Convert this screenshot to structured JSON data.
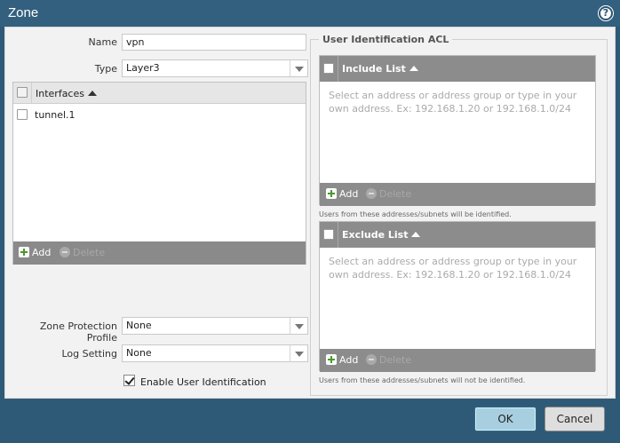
{
  "window": {
    "title": "Zone"
  },
  "form": {
    "name_label": "Name",
    "name_value": "vpn",
    "type_label": "Type",
    "type_value": "Layer3",
    "zpp_label": "Zone Protection Profile",
    "zpp_value": "None",
    "log_label": "Log Setting",
    "log_value": "None",
    "enable_uid_label": "Enable User Identification",
    "enable_uid_checked": true
  },
  "interfaces": {
    "header": "Interfaces",
    "rows": [
      "tunnel.1"
    ],
    "add_label": "Add",
    "delete_label": "Delete"
  },
  "acl": {
    "legend": "User Identification ACL",
    "include": {
      "header": "Include List",
      "placeholder": "Select an address or address group or type in your own address. Ex: 192.168.1.20 or 192.168.1.0/24",
      "add_label": "Add",
      "delete_label": "Delete",
      "hint": "Users from these addresses/subnets will be identified."
    },
    "exclude": {
      "header": "Exclude List",
      "placeholder": "Select an address or address group or type in your own address. Ex: 192.168.1.20 or 192.168.1.0/24",
      "add_label": "Add",
      "delete_label": "Delete",
      "hint": "Users from these addresses/subnets will not be identified."
    }
  },
  "footer": {
    "ok_label": "OK",
    "cancel_label": "Cancel"
  },
  "icons": {
    "help": "help-icon",
    "add": "plus-icon",
    "delete": "minus-icon",
    "sort": "sort-ascending-icon"
  },
  "colors": {
    "titlebar": "#33607e",
    "ok_button": "#a7cfe0",
    "panel_header": "#8c8c8c"
  }
}
